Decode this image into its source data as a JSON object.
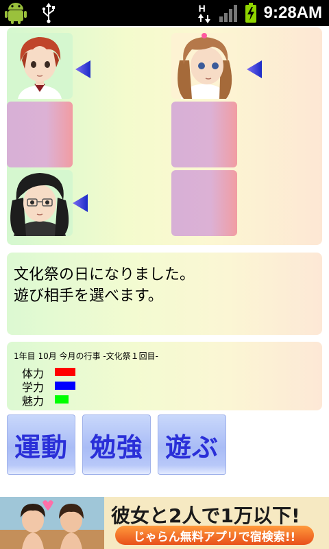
{
  "statusbar": {
    "time": "9:28AM",
    "network_label": "H",
    "icons": [
      "android-icon",
      "usb-icon",
      "network-h-icon",
      "signal-icon",
      "battery-charging-icon"
    ]
  },
  "message": {
    "line1": "文化祭の日になりました。",
    "line2": "遊び相手を選べます。"
  },
  "status": {
    "info": "1年目 10月 今月の行事 -文化祭１回目-",
    "stats": [
      {
        "label": "体力",
        "color": "#ff0000",
        "level": 0.8
      },
      {
        "label": "学力",
        "color": "#0000ff",
        "level": 0.8
      },
      {
        "label": "魅力",
        "color": "#00ff00",
        "level": 0.55
      }
    ]
  },
  "actions": [
    {
      "label": "運動"
    },
    {
      "label": "勉強"
    },
    {
      "label": "遊ぶ"
    }
  ],
  "ad": {
    "title": "彼女と2人で1万以下!",
    "subtitle": "じゃらん無料アプリで宿検索!!"
  },
  "colors": {
    "arrow": "#2e3bd6",
    "button_text": "#2a2fd8",
    "empty_slot": "#dcb1d5"
  }
}
